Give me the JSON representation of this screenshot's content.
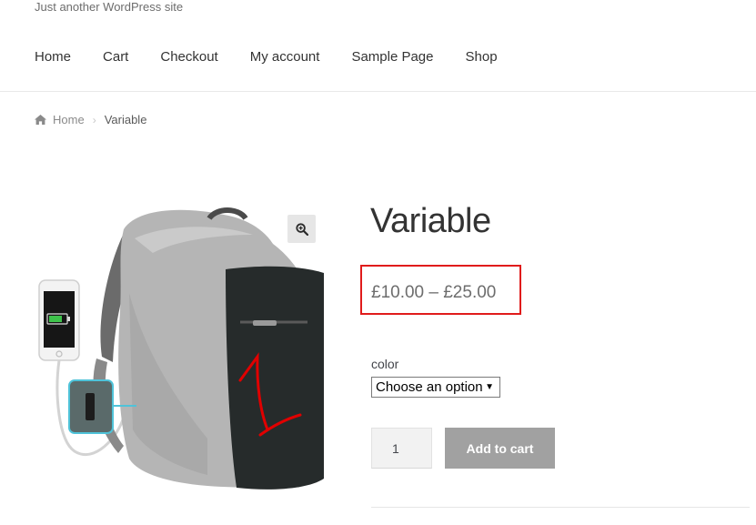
{
  "site": {
    "tagline": "Just another WordPress site"
  },
  "nav": {
    "items": [
      {
        "label": "Home"
      },
      {
        "label": "Cart"
      },
      {
        "label": "Checkout"
      },
      {
        "label": "My account"
      },
      {
        "label": "Sample Page"
      },
      {
        "label": "Shop"
      }
    ]
  },
  "breadcrumb": {
    "home": "Home",
    "current": "Variable",
    "home_icon": "home-icon",
    "separator_icon": "chevron-right-icon"
  },
  "product": {
    "title": "Variable",
    "price": "£10.00 – £25.00",
    "image_icon": "backpack-image",
    "zoom_icon": "zoom-icon",
    "option_label": "color",
    "option_selected": "Choose an option",
    "quantity": "1",
    "add_to_cart_label": "Add to cart"
  },
  "colors": {
    "highlight_border": "#e01b1b",
    "button_bg": "#a1a1a1"
  }
}
